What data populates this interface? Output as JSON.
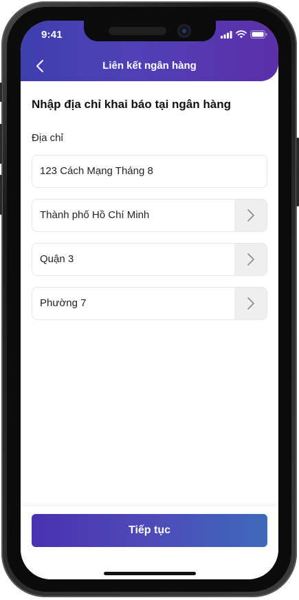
{
  "status_bar": {
    "time": "9:41",
    "icons": [
      "cellular-signal-icon",
      "wifi-icon",
      "battery-icon"
    ]
  },
  "header": {
    "title": "Liên kết ngân hàng",
    "back_icon": "chevron-left-icon"
  },
  "form": {
    "title": "Nhập địa chỉ khai báo tại ngân hàng",
    "address_label": "Địa chỉ",
    "address_value": "123 Cách Mạng Tháng 8",
    "city_value": "Thành phố Hồ Chí Minh",
    "district_value": "Quận 3",
    "ward_value": "Phường 7",
    "select_icon": "chevron-right-icon"
  },
  "footer": {
    "continue_label": "Tiếp tục"
  },
  "colors": {
    "header_gradient_start": "#3e3fae",
    "header_gradient_end": "#5b2fa8",
    "button_gradient_start": "#4a31b0",
    "button_gradient_end": "#3d6aba",
    "select_chevron_bg": "#efefef"
  }
}
